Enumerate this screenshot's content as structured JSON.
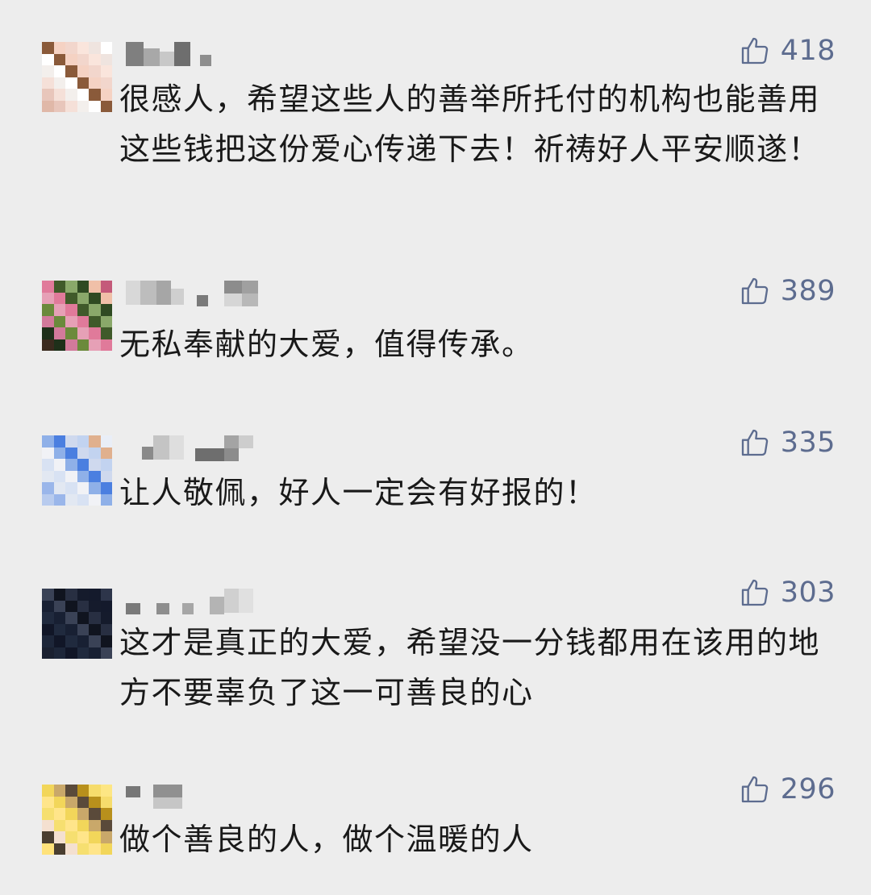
{
  "comments": [
    {
      "likes": "418",
      "text": "很感人，希望这些人的善举所托付的机构也能善用这些钱把这份爱心传递下去！祈祷好人平安顺遂！",
      "avatar_colors": [
        "#8a5a3a",
        "#e0b8a8",
        "#f2d6cc",
        "#f5e0d8",
        "#efe4df",
        "#ffffff",
        "#d99b82",
        "#f5d2c3",
        "#e8c6bb",
        "#fae5dc",
        "#f3efec",
        "#ffffff"
      ]
    },
    {
      "likes": "389",
      "text": "无私奉献的大爱，值得传承。",
      "avatar_colors": [
        "#2f4a22",
        "#6b8a3c",
        "#c45a7a",
        "#e07a9a",
        "#3a2a1e",
        "#8aa86a",
        "#d27a9b",
        "#f0c0a8",
        "#e6a0b6",
        "#c46f8c",
        "#405a2a",
        "#1e301a"
      ]
    },
    {
      "likes": "335",
      "text": "让人敬佩，好人一定会有好报的！",
      "avatar_colors": [
        "#3a6ed8",
        "#4b7fe0",
        "#9ab6ea",
        "#c2d3f0",
        "#d8e2f3",
        "#e9eef7",
        "#8fb0e8",
        "#b8cbee",
        "#cfd9ee",
        "#e2e8f2",
        "#e0b08e",
        "#f1f2f6"
      ]
    },
    {
      "likes": "303",
      "text": "这才是真正的大爱，希望没一分钱都用在该用的地方不要辜负了这一可善良的心",
      "avatar_colors": [
        "#111627",
        "#141a2c",
        "#182033",
        "#1b2336",
        "#10141f",
        "#1d2639",
        "#151b2c",
        "#202a3e",
        "#2d354a",
        "#3a4256",
        "#1a2030",
        "#282f42"
      ]
    },
    {
      "likes": "296",
      "text": "做个善良的人，做个温暖的人",
      "avatar_colors": [
        "#f2d65a",
        "#ffe27a",
        "#5a4a3a",
        "#f4e0d0",
        "#f6dc6c",
        "#ffe58a",
        "#6a5848",
        "#c9a86a",
        "#4a3e30",
        "#b8901c",
        "#f6df70",
        "#fde684"
      ]
    }
  ],
  "colors": {
    "background": "#ededed",
    "like_count": "#5d6c8f",
    "comment_text": "#191919"
  },
  "icons": {
    "like": "thumbs-up-icon"
  }
}
